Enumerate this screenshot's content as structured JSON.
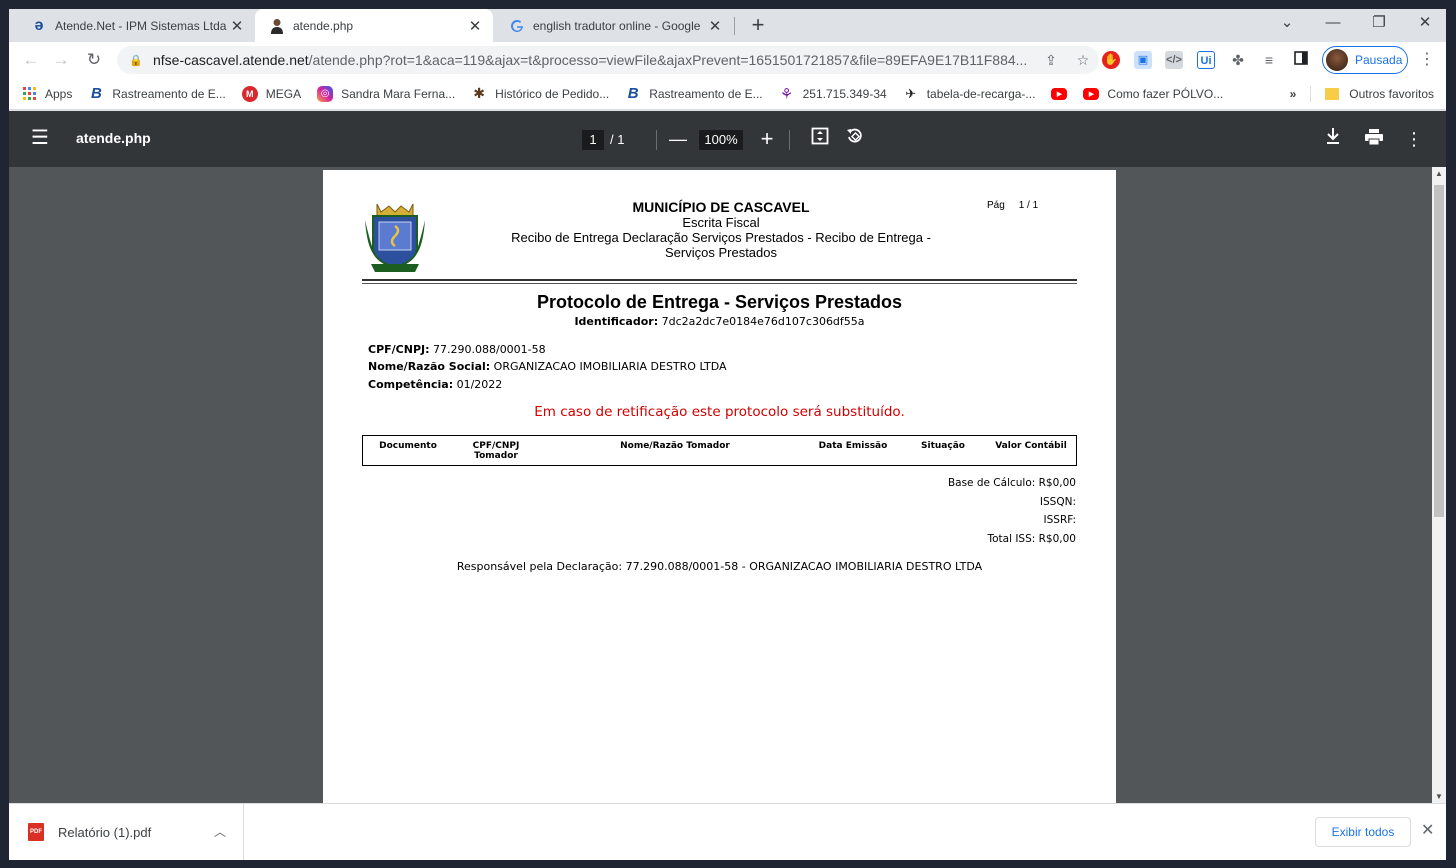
{
  "tabs": [
    {
      "title": "Atende.Net - IPM Sistemas Ltda -",
      "icon": "atende-logo-icon"
    },
    {
      "title": "atende.php",
      "icon": "person-icon"
    },
    {
      "title": "english tradutor online - Google",
      "icon": "google-icon"
    }
  ],
  "url": {
    "domain": "nfse-cascavel.atende.net",
    "path": "/atende.php?rot=1&aca=119&ajax=t&processo=viewFile&ajaxPrevent=1651501721857&file=89EFA9E17B11F884..."
  },
  "profile": {
    "label": "Pausada"
  },
  "bookmarks": [
    {
      "label": "Apps",
      "icon": "apps-grid-icon"
    },
    {
      "label": "Rastreamento de E...",
      "icon": "b-logo-icon"
    },
    {
      "label": "MEGA",
      "icon": "mega-icon"
    },
    {
      "label": "Sandra Mara Ferna...",
      "icon": "instagram-icon"
    },
    {
      "label": "Histórico de Pedido...",
      "icon": "history-icon"
    },
    {
      "label": "Rastreamento de E...",
      "icon": "b-logo-icon"
    },
    {
      "label": "251.715.349-34",
      "icon": "person-star-icon"
    },
    {
      "label": "tabela-de-recarga-...",
      "icon": "bird-icon"
    },
    {
      "label": "",
      "icon": "youtube-icon"
    },
    {
      "label": "Como fazer PÓLVO...",
      "icon": "youtube-icon"
    }
  ],
  "bookmarks_more": "»",
  "bookmarks_other": "Outros favoritos",
  "pdf_viewer": {
    "title": "atende.php",
    "page_current": "1",
    "page_total": "/ 1",
    "zoom": "100%"
  },
  "document": {
    "municipio": "MUNICÍPIO DE CASCAVEL",
    "escrita": "Escrita Fiscal",
    "recibo_line1": "Recibo de Entrega Declaração Serviços Prestados - Recibo de Entrega -",
    "recibo_line2": "Serviços Prestados",
    "pag_label": "Pág",
    "pag_value": "1  /  1",
    "protocolo_title": "Protocolo de Entrega - Serviços Prestados",
    "identificador_label": "Identificador:",
    "identificador_value": "7dc2a2dc7e0184e76d107c306df55a",
    "cpf_label": "CPF/CNPJ:",
    "cpf_value": "77.290.088/0001-58",
    "nome_label": "Nome/Razão Social:",
    "nome_value": "ORGANIZACAO IMOBILIARIA DESTRO LTDA",
    "competencia_label": "Competência:",
    "competencia_value": "01/2022",
    "warning": "Em caso de retificação este protocolo será substituído.",
    "table_headers": [
      "Documento",
      "CPF/CNPJ",
      "Tomador",
      "Nome/Razão Tomador",
      "Data Emissão",
      "Situação",
      "Valor Contábil"
    ],
    "base_calculo": "Base de Cálculo: R$0,00",
    "issqn": "ISSQN:",
    "issrf": "ISSRF:",
    "total_iss": "Total ISS: R$0,00",
    "responsavel": "Responsável pela Declaração: 77.290.088/0001-58 - ORGANIZACAO IMOBILIARIA DESTRO LTDA"
  },
  "download": {
    "filename": "Relatório (1).pdf",
    "show_all": "Exibir todos"
  }
}
